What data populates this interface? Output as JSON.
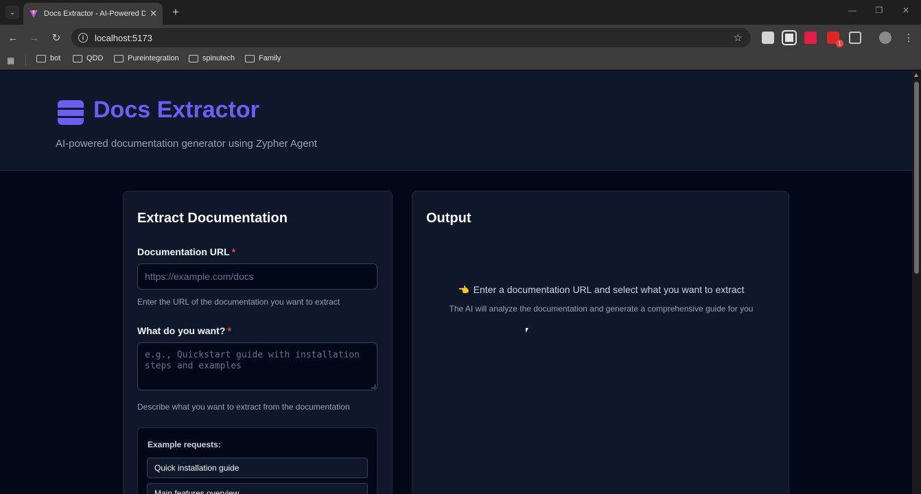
{
  "browser": {
    "tab_title": "Docs Extractor - AI-Powered Do",
    "url": "localhost:5173",
    "extension_badge": "1",
    "bookmarks": [
      "bot",
      "QDD",
      "Pureintegration",
      "spinutech",
      "Family"
    ]
  },
  "header": {
    "title": "Docs Extractor",
    "subtitle": "AI-powered documentation generator using Zypher Agent"
  },
  "form": {
    "title": "Extract Documentation",
    "url_label": "Documentation URL",
    "required_mark": "*",
    "url_placeholder": "https://example.com/docs",
    "url_help": "Enter the URL of the documentation you want to extract",
    "want_label": "What do you want?",
    "want_placeholder": "e.g., Quickstart guide with installation steps and examples",
    "want_help": "Describe what you want to extract from the documentation",
    "examples_label": "Example requests:",
    "examples": [
      "Quick installation guide",
      "Main features overview"
    ]
  },
  "output": {
    "title": "Output",
    "empty_message": "Enter a documentation URL and select what you want to extract",
    "empty_sub": "The AI will analyze the documentation and generate a comprehensive guide for you"
  },
  "colors": {
    "accent": "#6d5ef3",
    "required": "#ef4444",
    "background": "#020817",
    "card": "#0f172a"
  }
}
